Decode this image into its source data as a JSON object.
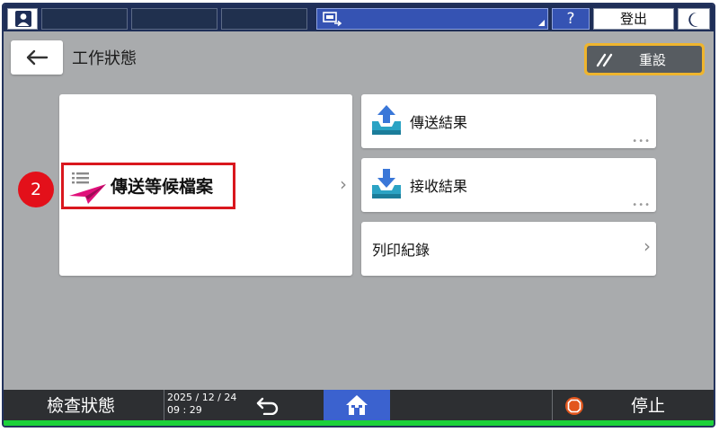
{
  "topbar": {
    "help_label": "?",
    "logout_label": "登出"
  },
  "header": {
    "title": "工作狀態",
    "reset_label": "重設"
  },
  "main": {
    "queue_label": "傳送等候檔案",
    "step_number": "2",
    "send_result_label": "傳送結果",
    "receive_result_label": "接收結果",
    "print_log_label": "列印紀錄",
    "more_dots": "•••",
    "chevron": "›"
  },
  "bottombar": {
    "check_status_label": "檢查狀態",
    "date": "2025 / 12 / 24",
    "time": "09 : 29",
    "stop_label": "停止"
  },
  "colors": {
    "topbar": "#1e2e57",
    "accent_blue": "#3553b3",
    "highlight_red": "#d9171e",
    "reset_border": "#efb52e",
    "status_green": "#1cd13a"
  }
}
